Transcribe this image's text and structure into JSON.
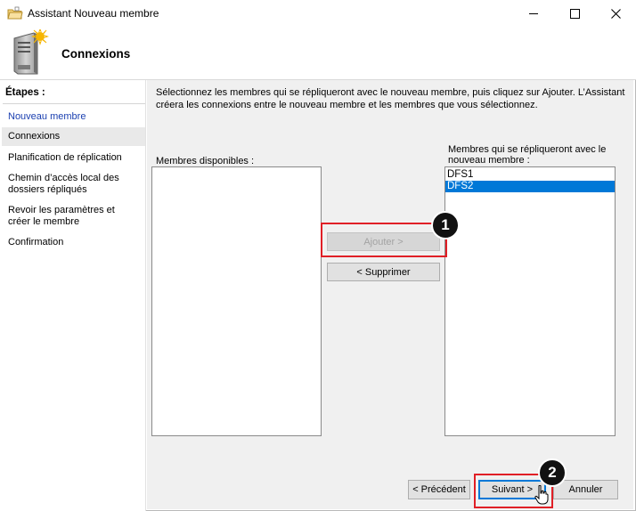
{
  "window": {
    "title": "Assistant Nouveau membre",
    "controls": {
      "minimize": "—",
      "maximize": "☐",
      "close": "✕"
    }
  },
  "header": {
    "title": "Connexions",
    "icon": "server-icon"
  },
  "steps": {
    "heading": "Étapes :",
    "items": [
      {
        "label": "Nouveau membre",
        "state": "done"
      },
      {
        "label": "Connexions",
        "state": "current"
      },
      {
        "label": "Planification de réplication",
        "state": "pending"
      },
      {
        "label": "Chemin d’accès local des dossiers répliqués",
        "state": "pending"
      },
      {
        "label": "Revoir les paramètres et créer le membre",
        "state": "pending"
      },
      {
        "label": "Confirmation",
        "state": "pending"
      }
    ]
  },
  "main": {
    "instructions": "Sélectionnez les membres qui se répliqueront avec le nouveau membre, puis cliquez sur Ajouter. L’Assistant créera les connexions entre le nouveau membre et les membres que vous sélectionnez.",
    "available": {
      "label": "Membres disponibles :",
      "items": []
    },
    "replicating": {
      "label": "Membres qui se répliqueront avec le nouveau membre :",
      "items": [
        {
          "name": "DFS1",
          "selected": false
        },
        {
          "name": "DFS2",
          "selected": true
        }
      ]
    },
    "add_button": "Ajouter >",
    "remove_button": "< Supprimer"
  },
  "footer": {
    "previous": "< Précédent",
    "next": "Suivant >",
    "cancel": "Annuler"
  },
  "annotations": {
    "badge1": "1",
    "badge2": "2",
    "highlight_color": "#e01f26"
  },
  "colors": {
    "selection": "#0078d7",
    "step_link": "#1a3fb0"
  }
}
